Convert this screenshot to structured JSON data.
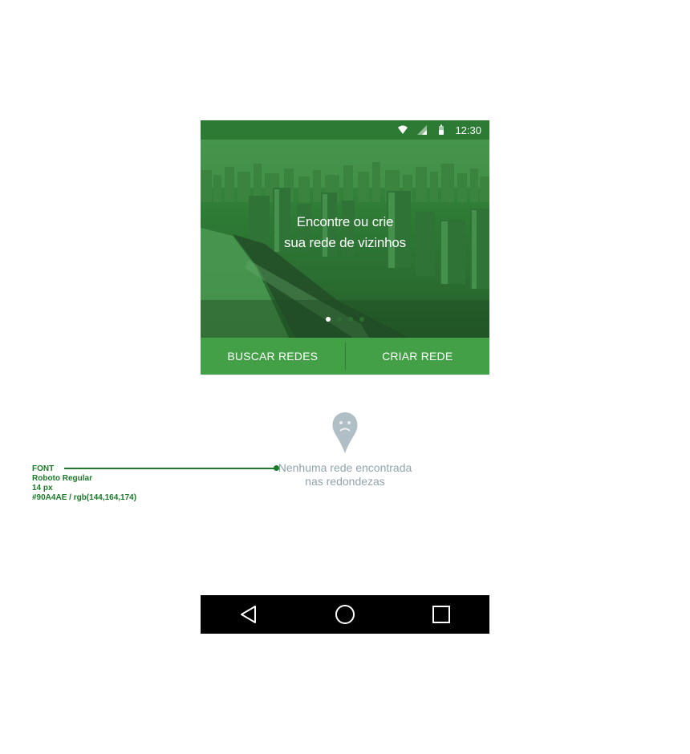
{
  "status_bar": {
    "time": "12:30",
    "icons": [
      "wifi-icon",
      "signal-icon",
      "battery-icon"
    ]
  },
  "hero": {
    "title_line1": "Encontre ou crie",
    "title_line2": "sua rede de vizinhos",
    "pager": {
      "count": 4,
      "active": 1
    }
  },
  "actions": {
    "search_label": "BUSCAR REDES",
    "create_label": "CRIAR REDE"
  },
  "empty_state": {
    "icon": "sad-map-pin-icon",
    "line1": "Nenhuma rede encontrada",
    "line2": "nas redondezas"
  },
  "annotation": {
    "title": "FONT",
    "font": "Roboto Regular",
    "size": "14 px",
    "color": "#90A4AE / rgb(144,164,174)"
  },
  "navbar": {
    "icons": [
      "back-icon",
      "home-icon",
      "recents-icon"
    ]
  },
  "colors": {
    "primary": "#43a047",
    "status_bar": "#2c7a33",
    "empty_text": "#90A4AE",
    "annotation": "#1a7a28"
  }
}
